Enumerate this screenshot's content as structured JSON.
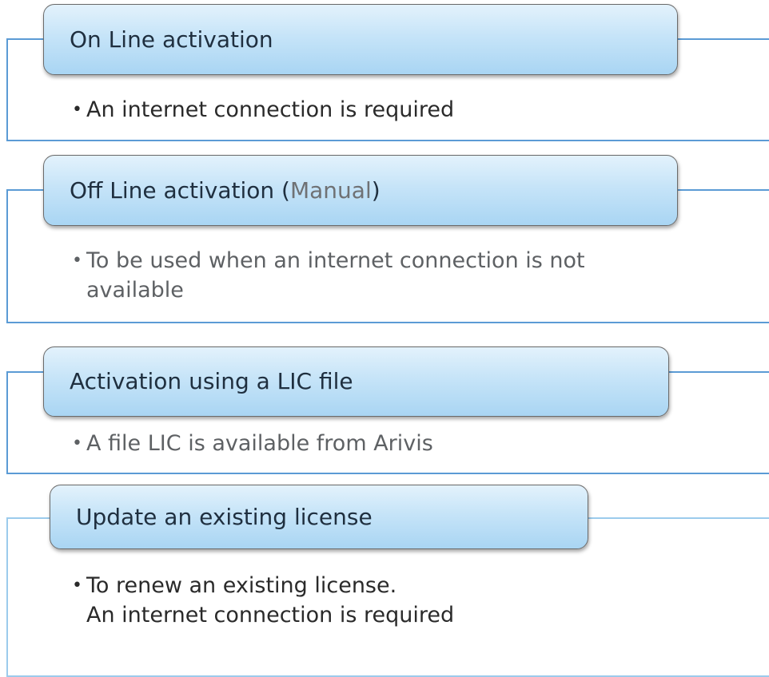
{
  "blocks": [
    {
      "title": "On Line activation",
      "bullet": "An internet connection is required"
    },
    {
      "title_main": "Off Line activation (",
      "title_accent": "Manual",
      "title_end": ")",
      "bullet_line1": "To be used when an internet connection is not",
      "bullet_line2": "available"
    },
    {
      "title": "Activation using a LIC file",
      "bullet": "A file LIC is available from Arivis"
    },
    {
      "title": "Update an existing license",
      "bullet_line1": "To renew an existing license.",
      "bullet_line2": "An internet connection is required"
    }
  ],
  "bullet_symbol": "•",
  "colors": {
    "frame": "#5b9bd5",
    "frame_light": "#9ccbec",
    "header_top": "#e3f2fc",
    "header_bottom": "#a9d5f3"
  }
}
